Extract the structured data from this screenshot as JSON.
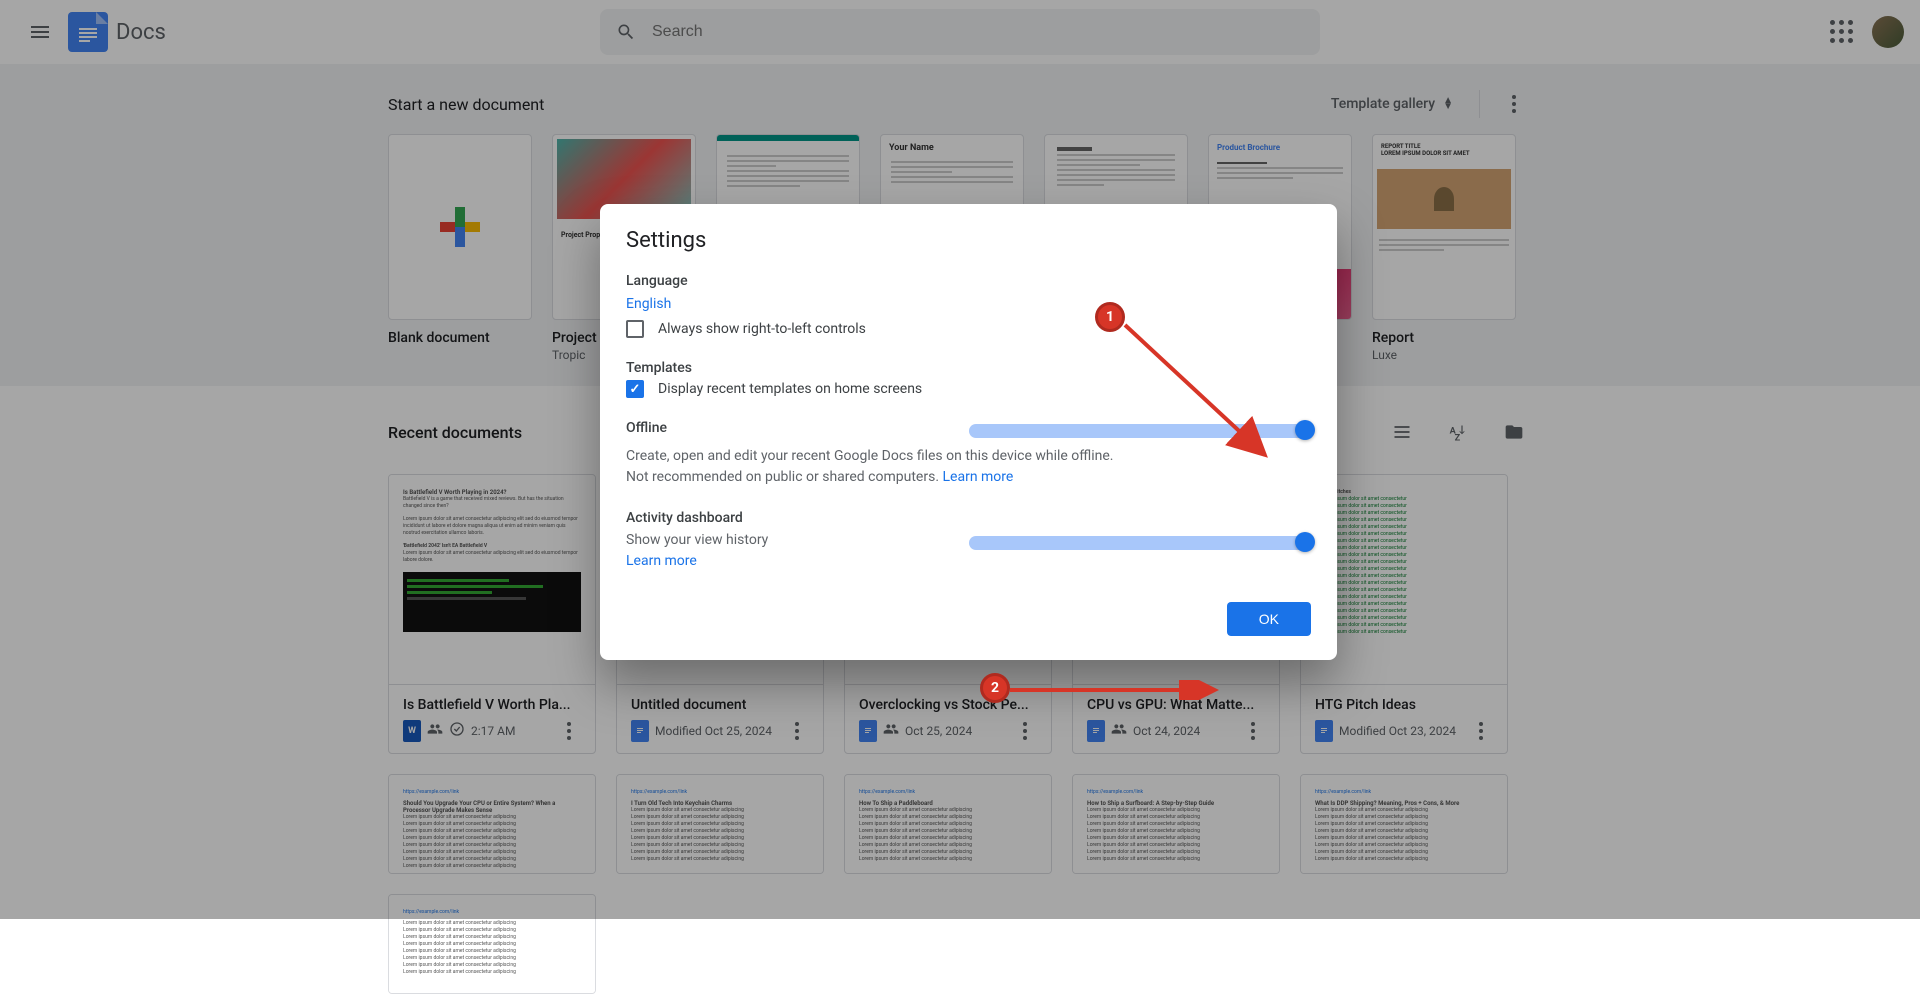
{
  "header": {
    "app_name": "Docs",
    "search_placeholder": "Search"
  },
  "templates": {
    "heading": "Start a new document",
    "gallery_btn": "Template gallery",
    "items": [
      {
        "title": "Blank document",
        "sub": ""
      },
      {
        "title": "Project",
        "sub": "Tropic"
      },
      {
        "title": "",
        "sub": ""
      },
      {
        "title": "Your Name",
        "sub": ""
      },
      {
        "title": "",
        "sub": ""
      },
      {
        "title": "Product Brochure",
        "sub": ""
      },
      {
        "title": "Report",
        "sub": "Luxe"
      }
    ]
  },
  "recent": {
    "heading": "Recent documents",
    "docs": [
      {
        "title": "Is Battlefield V Worth Pla...",
        "date": "2:17 AM",
        "type": "word",
        "shared": true,
        "badge": true,
        "prefix": ""
      },
      {
        "title": "Untitled document",
        "date": "Oct 25, 2024",
        "type": "docs",
        "shared": false,
        "badge": false,
        "prefix": "Modified "
      },
      {
        "title": "Overclocking vs Stock Pe...",
        "date": "Oct 25, 2024",
        "type": "docs",
        "shared": true,
        "badge": false,
        "prefix": ""
      },
      {
        "title": "CPU vs GPU: What Matte...",
        "date": "Oct 24, 2024",
        "type": "docs",
        "shared": true,
        "badge": false,
        "prefix": ""
      },
      {
        "title": "HTG Pitch Ideas",
        "date": "Oct 23, 2024",
        "type": "docs",
        "shared": false,
        "badge": false,
        "prefix": "Modified "
      }
    ]
  },
  "dialog": {
    "title": "Settings",
    "language": {
      "heading": "Language",
      "value": "English",
      "rtl_label": "Always show right-to-left controls"
    },
    "templates_sec": {
      "heading": "Templates",
      "display_label": "Display recent templates on home screens"
    },
    "offline": {
      "heading": "Offline",
      "desc": "Create, open and edit your recent Google Docs files on this device while offline.",
      "warn": "Not recommended on public or shared computers.",
      "learn": "Learn more"
    },
    "activity": {
      "heading": "Activity dashboard",
      "desc": "Show your view history",
      "learn": "Learn more"
    },
    "ok": "OK"
  },
  "annotations": {
    "one": "1",
    "two": "2"
  }
}
